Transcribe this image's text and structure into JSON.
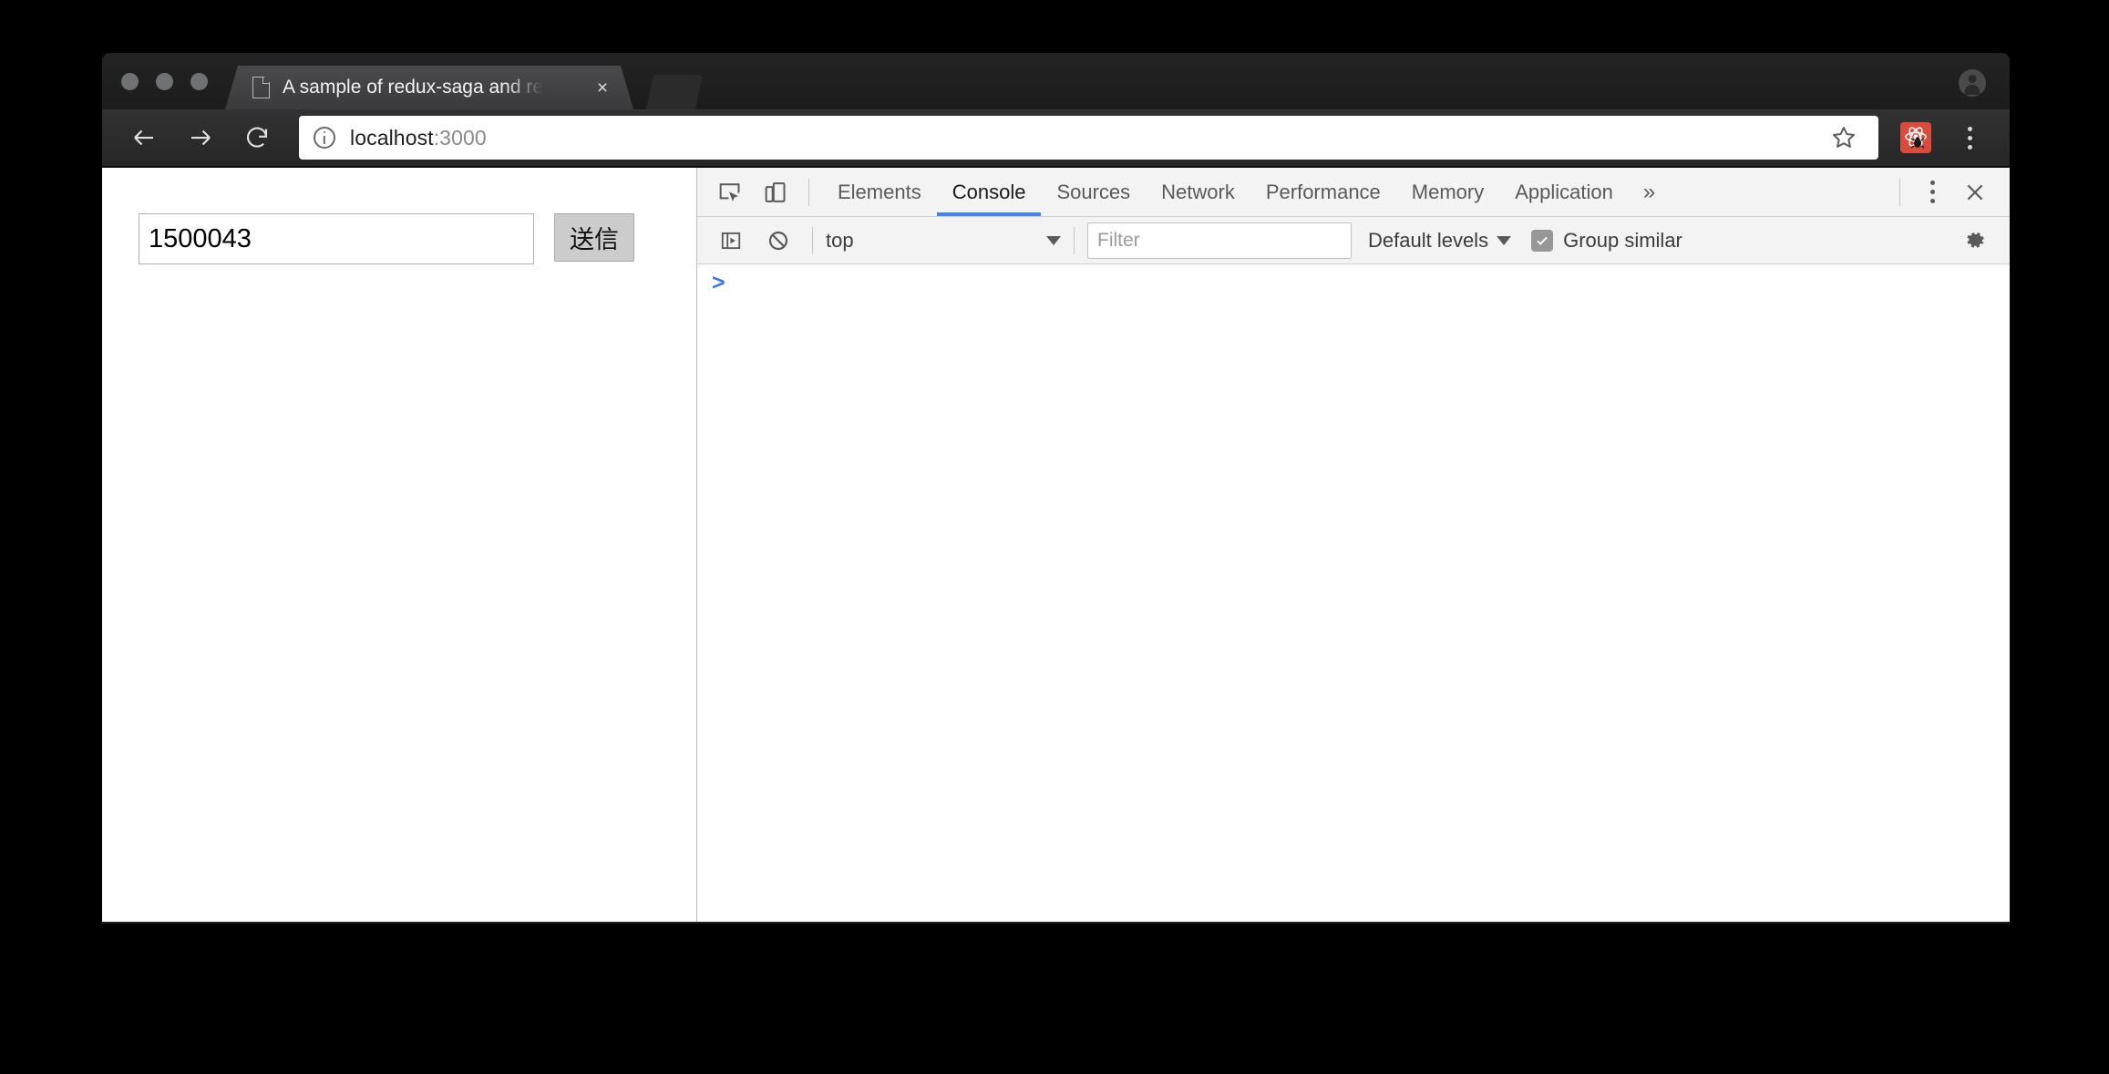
{
  "window": {
    "traffic_lights": [
      "close",
      "minimize",
      "maximize"
    ]
  },
  "tab": {
    "title": "A sample of redux-saga and re",
    "favicon": "document-icon",
    "close_label": "×",
    "new_tab_label": ""
  },
  "toolbar": {
    "back_label": "Back",
    "forward_label": "Forward",
    "reload_label": "Reload",
    "page_info_icon": "info-icon",
    "url_main": "localhost",
    "url_suffix": ":3000",
    "bookmark_icon": "star-icon",
    "extension_icon": "react-devtools-icon",
    "menu_icon": "kebab-menu-icon"
  },
  "page": {
    "input_value": "1500043",
    "input_placeholder": "",
    "submit_label": "送信"
  },
  "devtools": {
    "inspect_icon": "inspect-element-icon",
    "device_icon": "device-toolbar-icon",
    "tabs": [
      {
        "label": "Elements",
        "active": false
      },
      {
        "label": "Console",
        "active": true
      },
      {
        "label": "Sources",
        "active": false
      },
      {
        "label": "Network",
        "active": false
      },
      {
        "label": "Performance",
        "active": false
      },
      {
        "label": "Memory",
        "active": false
      },
      {
        "label": "Application",
        "active": false
      }
    ],
    "overflow_label": "»",
    "more_icon": "kebab-menu-icon",
    "close_icon": "close-icon",
    "console": {
      "sidebar_toggle_icon": "console-sidebar-icon",
      "clear_icon": "clear-console-icon",
      "context": "top",
      "filter_placeholder": "Filter",
      "filter_value": "",
      "levels_label": "Default levels",
      "group_similar_label": "Group similar",
      "group_similar_checked": true,
      "settings_icon": "gear-icon",
      "prompt_symbol": ">",
      "prompt_value": ""
    }
  },
  "colors": {
    "accent_blue": "#4285f4",
    "prompt_blue": "#3b78e7",
    "extension_red": "#d94c3d",
    "devtools_chrome": "#f3f3f3",
    "tab_strip": "#1f1f1f"
  }
}
